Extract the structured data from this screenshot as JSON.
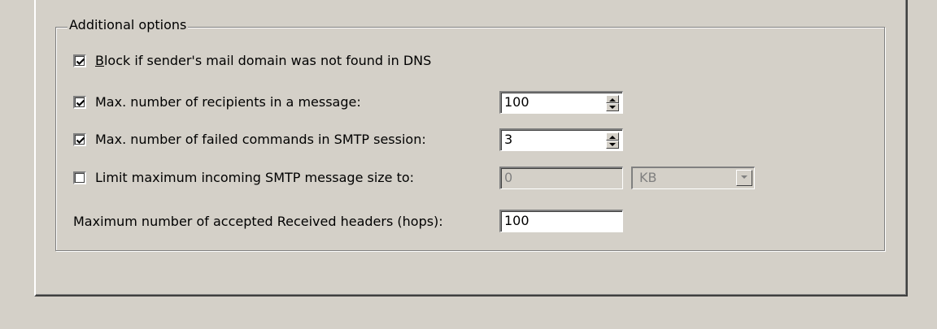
{
  "group": {
    "title": "Additional options"
  },
  "options": [
    {
      "checked": true,
      "label_mnemonic": "B",
      "label_rest": "lock if sender's mail domain was not found in DNS"
    },
    {
      "checked": true,
      "label": "Max. number of recipients in a message:",
      "value": "100"
    },
    {
      "checked": true,
      "label": "Max. number of failed commands in SMTP session:",
      "value": "3"
    },
    {
      "checked": false,
      "label": "Limit maximum incoming SMTP message size to:",
      "value": "0",
      "unit": "KB"
    }
  ],
  "hops": {
    "label": "Maximum number of accepted Received headers (hops):",
    "value": "100"
  },
  "icons": {
    "check": "checkmark-icon",
    "spin_up": "spin-up-arrow-icon",
    "spin_down": "spin-down-arrow-icon",
    "dropdown": "dropdown-arrow-icon"
  },
  "colors": {
    "face": "#d4d0c8",
    "shadow": "#808080",
    "highlight": "#ffffff",
    "disabled_text": "#808080"
  }
}
